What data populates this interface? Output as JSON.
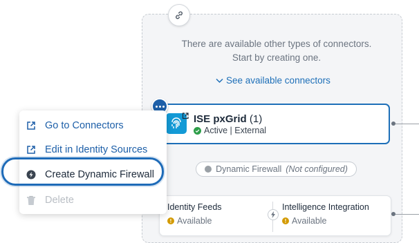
{
  "empty_state": {
    "line1": "There are available other types of connectors.",
    "line2": "Start by creating one.",
    "see_link": "See available connectors"
  },
  "ise_card": {
    "title": "ISE pxGrid",
    "count": "(1)",
    "status": "Active | External"
  },
  "dynamic_firewall": {
    "label": "Dynamic Firewall",
    "state": "(Not configured)"
  },
  "bottom_card": {
    "left_label": "Identity Feeds",
    "left_status": "Available",
    "right_label": "Intelligence Integration",
    "right_status": "Available"
  },
  "context_menu": {
    "items": [
      {
        "label": "Go to Connectors",
        "icon": "external-link-icon"
      },
      {
        "label": "Edit in Identity Sources",
        "icon": "external-link-icon"
      },
      {
        "label": "Create Dynamic Firewall",
        "icon": "firewall-bolt-icon"
      },
      {
        "label": "Delete",
        "icon": "trash-icon"
      }
    ]
  },
  "colors": {
    "accent": "#1d6fb8",
    "active": "#2e9e4a",
    "warning": "#d39a00",
    "ise_tile": "#139ad6"
  }
}
